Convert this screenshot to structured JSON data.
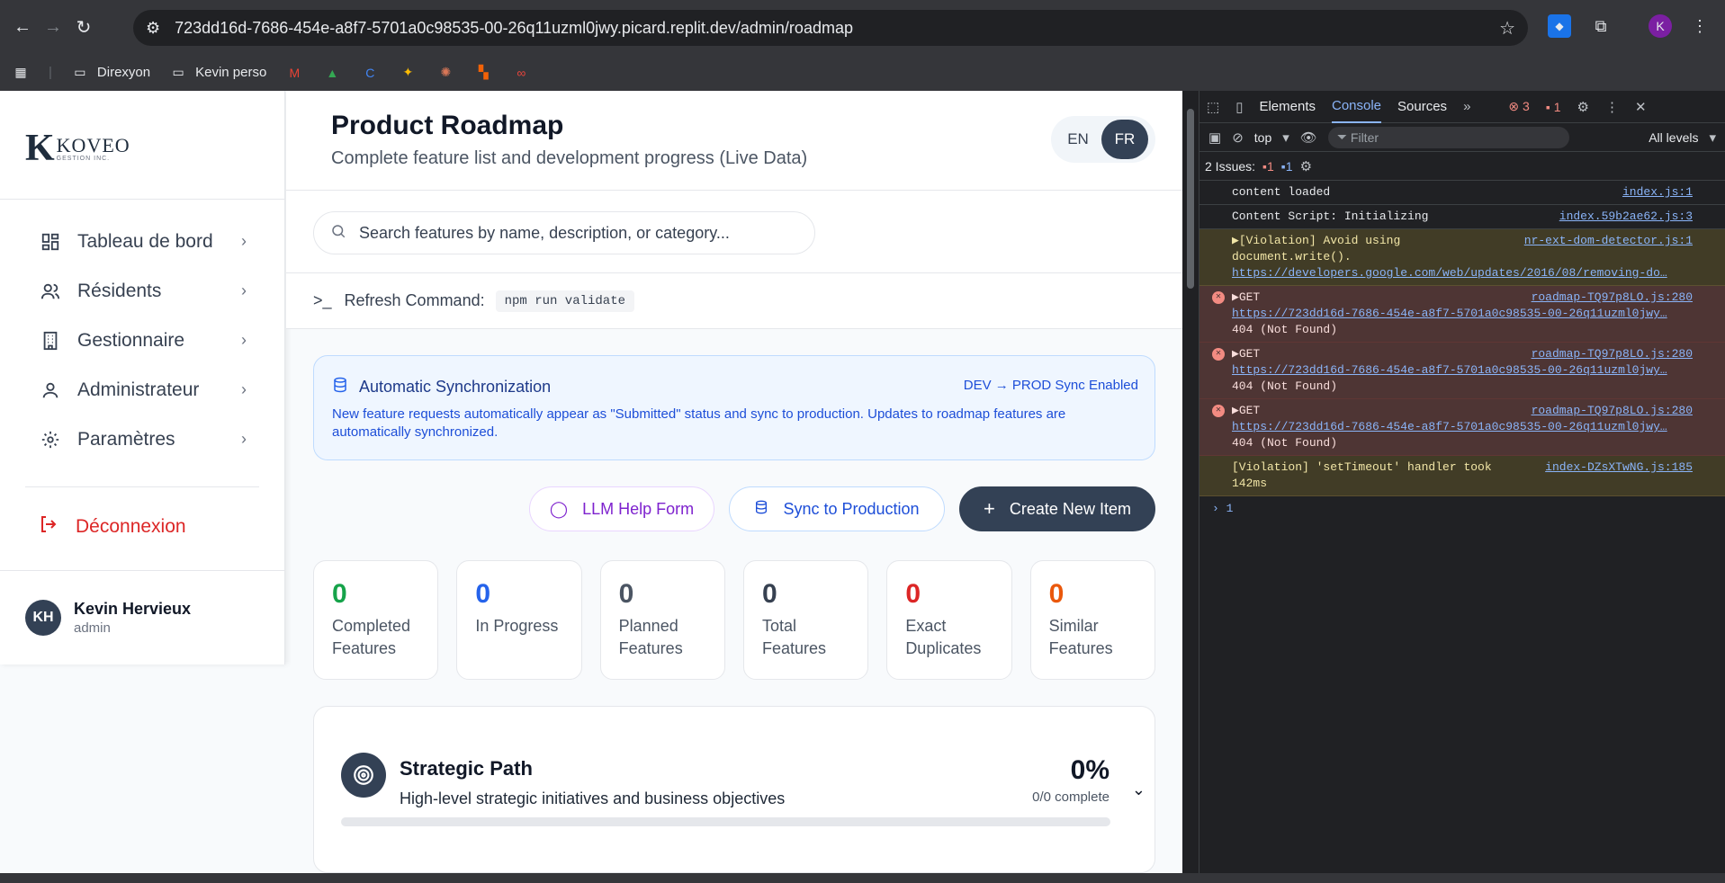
{
  "browser": {
    "url": "723dd16d-7686-454e-a8f7-5701a0c98535-00-26q11uzml0jwy.picard.replit.dev/admin/roadmap",
    "avatar_letter": "K",
    "bookmarks": [
      "Direxyon",
      "Kevin perso"
    ]
  },
  "sidebar": {
    "logo_text": "KOVEO",
    "logo_sub": "GESTION INC.",
    "items": [
      {
        "label": "Tableau de bord",
        "icon": "dashboard-icon"
      },
      {
        "label": "Résidents",
        "icon": "users-icon"
      },
      {
        "label": "Gestionnaire",
        "icon": "building-icon"
      },
      {
        "label": "Administrateur",
        "icon": "user-icon"
      },
      {
        "label": "Paramètres",
        "icon": "gear-icon"
      }
    ],
    "logout": "Déconnexion",
    "user": {
      "initials": "KH",
      "name": "Kevin Hervieux",
      "role": "admin"
    }
  },
  "header": {
    "title": "Product Roadmap",
    "subtitle": "Complete feature list and development progress (Live Data)",
    "lang_en": "EN",
    "lang_fr": "FR"
  },
  "search": {
    "placeholder": "Search features by name, description, or category..."
  },
  "refresh": {
    "label": "Refresh Command:",
    "command": "npm run validate"
  },
  "sync": {
    "title": "Automatic Synchronization",
    "status": "DEV → PROD Sync Enabled",
    "description": "New feature requests automatically appear as \"Submitted\" status and sync to production. Updates to roadmap features are automatically synchronized."
  },
  "actions": {
    "llm": "LLM Help Form",
    "sync": "Sync to Production",
    "create": "Create New Item"
  },
  "stats": [
    {
      "value": "0",
      "label": "Completed Features",
      "color": "#16a34a"
    },
    {
      "value": "0",
      "label": "In Progress",
      "color": "#2563eb"
    },
    {
      "value": "0",
      "label": "Planned Features",
      "color": "#4b5563"
    },
    {
      "value": "0",
      "label": "Total Features",
      "color": "#374151"
    },
    {
      "value": "0",
      "label": "Exact Duplicates",
      "color": "#dc2626"
    },
    {
      "value": "0",
      "label": "Similar Features",
      "color": "#ea580c"
    }
  ],
  "strategic": {
    "title": "Strategic Path",
    "description": "High-level strategic initiatives and business objectives",
    "percent": "0%",
    "complete": "0/0 complete",
    "progress": 0
  },
  "devtools": {
    "tabs": [
      "Elements",
      "Console",
      "Sources"
    ],
    "errors": "3",
    "issues_badge": "1",
    "context": "top",
    "filter": "Filter",
    "levels": "All levels",
    "issues": "2 Issues:",
    "issue_err": "1",
    "issue_info": "1",
    "logs": [
      {
        "type": "info",
        "text": "content loaded",
        "src": "index.js:1"
      },
      {
        "type": "info",
        "text": "Content Script: Initializing",
        "src": "index.59b2ae62.js:3"
      },
      {
        "type": "warn",
        "text": "▶[Violation] Avoid using document.write().",
        "link": "https://developers.google.com/web/updates/2016/08/removing-do…",
        "src": "nr-ext-dom-detector.js:1"
      },
      {
        "type": "err",
        "text": "▶GET",
        "link": "https://723dd16d-7686-454e-a8f7-5701a0c98535-00-26q11uzml0jwy…",
        "tail": "404 (Not Found)",
        "src": "roadmap-TQ97p8LO.js:280"
      },
      {
        "type": "err",
        "text": "▶GET",
        "link": "https://723dd16d-7686-454e-a8f7-5701a0c98535-00-26q11uzml0jwy…",
        "tail": "404 (Not Found)",
        "src": "roadmap-TQ97p8LO.js:280"
      },
      {
        "type": "err",
        "text": "▶GET",
        "link": "https://723dd16d-7686-454e-a8f7-5701a0c98535-00-26q11uzml0jwy…",
        "tail": "404 (Not Found)",
        "src": "roadmap-TQ97p8LO.js:280"
      },
      {
        "type": "warn",
        "text": "[Violation] 'setTimeout' handler took 142ms",
        "src": "index-DZsXTwNG.js:185"
      }
    ],
    "prompt": "1"
  }
}
